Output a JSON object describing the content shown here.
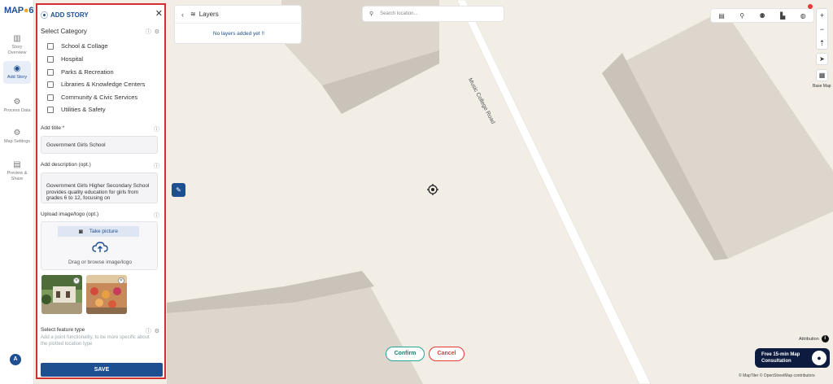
{
  "app": {
    "logo_text_pre": "MAP",
    "logo_text_post": "6"
  },
  "rail": [
    {
      "label": "Story Overview",
      "icon": "map-icon",
      "glyph": "▥"
    },
    {
      "label": "Add Story",
      "icon": "location-pin-icon",
      "glyph": "◉"
    },
    {
      "label": "Process Data",
      "icon": "gear-icon",
      "glyph": "⚙"
    },
    {
      "label": "Map Settings",
      "icon": "settings-icon",
      "glyph": "⚙"
    },
    {
      "label": "Preview & Share",
      "icon": "preview-icon",
      "glyph": "▤"
    }
  ],
  "user": {
    "initial": "A"
  },
  "panel": {
    "title": "ADD STORY",
    "close": "✕",
    "select_category_label": "Select Category",
    "categories": [
      "School & Collage",
      "Hospital",
      "Parks & Recreation",
      "Libraries & Knowledge Centers",
      "Community & Civic Services",
      "Utilities & Safety"
    ],
    "title_label": "Add titile *",
    "title_value": "Government Girls School",
    "description_label": "Add description (opt.)",
    "description_value": "Government Girls Higher Secondary School provides quality education for girls from grades 6 to 12, focusing on",
    "upload_label": "Upload image/logo (opt.)",
    "take_picture": "Take picture",
    "browse_text": "Drag or browse image/logo",
    "feature_type_label": "Select feature type",
    "feature_type_hint": "Add a point functionality, to be more specific about the plotted location type",
    "save_label": "SAVE"
  },
  "layers": {
    "title": "Layers",
    "empty": "No layers added yet !!"
  },
  "search": {
    "placeholder": "Search location..."
  },
  "map": {
    "road_label": "Music College Road",
    "confirm_label": "Confirm",
    "cancel_label": "Cancel",
    "basemap_label": "Base Map",
    "attribution_label": "Attribution",
    "consult_label_1": "Free 15-min Map",
    "consult_label_2": "Consultation",
    "copyright": "© MapTiler © OpenStreetMap contributors"
  },
  "colors": {
    "brand": "#1d4f91",
    "accent_orange": "#f5a623",
    "danger": "#e53935",
    "confirm": "#26a69a"
  }
}
